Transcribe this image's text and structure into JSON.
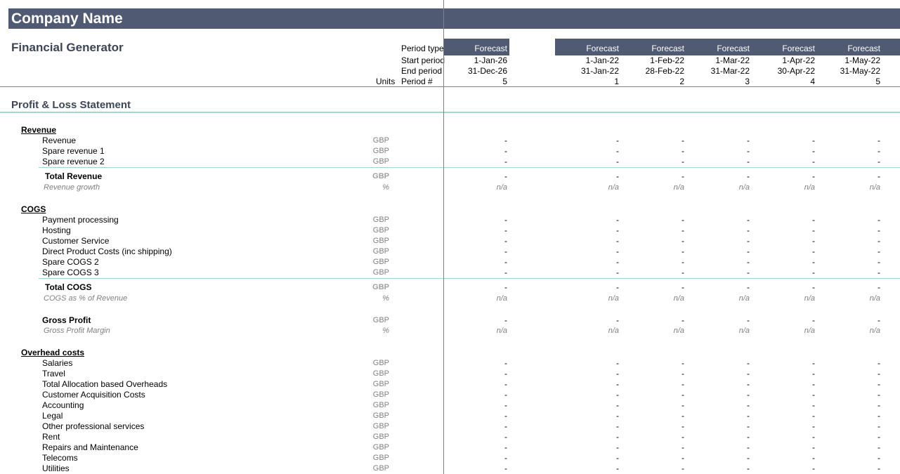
{
  "company_name": "Company Name",
  "app_title": "Financial Generator",
  "header_labels": {
    "period_type": "Period type",
    "start_period": "Start period",
    "end_period": "End period",
    "period_num": "Period #",
    "units": "Units"
  },
  "columns": [
    {
      "type": "Forecast",
      "start": "1-Jan-26",
      "end": "31-Dec-26",
      "period": "5"
    },
    {
      "type": "Forecast",
      "start": "1-Jan-22",
      "end": "31-Jan-22",
      "period": "1"
    },
    {
      "type": "Forecast",
      "start": "1-Feb-22",
      "end": "28-Feb-22",
      "period": "2"
    },
    {
      "type": "Forecast",
      "start": "1-Mar-22",
      "end": "31-Mar-22",
      "period": "3"
    },
    {
      "type": "Forecast",
      "start": "1-Apr-22",
      "end": "30-Apr-22",
      "period": "4"
    },
    {
      "type": "Forecast",
      "start": "1-May-22",
      "end": "31-May-22",
      "period": "5"
    }
  ],
  "section_title": "Profit & Loss Statement",
  "rows": [
    {
      "kind": "head",
      "label": "Revenue",
      "unit": "",
      "values": []
    },
    {
      "kind": "item",
      "label": "Revenue",
      "unit": "GBP",
      "values": [
        "-",
        "-",
        "-",
        "-",
        "-",
        "-"
      ]
    },
    {
      "kind": "item",
      "label": "Spare revenue 1",
      "unit": "GBP",
      "values": [
        "-",
        "-",
        "-",
        "-",
        "-",
        "-"
      ]
    },
    {
      "kind": "item",
      "label": "Spare revenue 2",
      "unit": "GBP",
      "values": [
        "-",
        "-",
        "-",
        "-",
        "-",
        "-"
      ]
    },
    {
      "kind": "total",
      "label": "Total Revenue",
      "unit": "GBP",
      "values": [
        "-",
        "-",
        "-",
        "-",
        "-",
        "-"
      ]
    },
    {
      "kind": "ratio",
      "label": "Revenue growth",
      "unit": "%",
      "values": [
        "n/a",
        "n/a",
        "n/a",
        "n/a",
        "n/a",
        "n/a"
      ]
    },
    {
      "kind": "head",
      "label": "COGS",
      "unit": "",
      "values": []
    },
    {
      "kind": "item",
      "label": "Payment processing",
      "unit": "GBP",
      "values": [
        "-",
        "-",
        "-",
        "-",
        "-",
        "-"
      ]
    },
    {
      "kind": "item",
      "label": "Hosting",
      "unit": "GBP",
      "values": [
        "-",
        "-",
        "-",
        "-",
        "-",
        "-"
      ]
    },
    {
      "kind": "item",
      "label": "Customer Service",
      "unit": "GBP",
      "values": [
        "-",
        "-",
        "-",
        "-",
        "-",
        "-"
      ]
    },
    {
      "kind": "item",
      "label": "Direct Product Costs (inc shipping)",
      "unit": "GBP",
      "values": [
        "-",
        "-",
        "-",
        "-",
        "-",
        "-"
      ]
    },
    {
      "kind": "item",
      "label": "Spare COGS 2",
      "unit": "GBP",
      "values": [
        "-",
        "-",
        "-",
        "-",
        "-",
        "-"
      ]
    },
    {
      "kind": "item",
      "label": "Spare COGS 3",
      "unit": "GBP",
      "values": [
        "-",
        "-",
        "-",
        "-",
        "-",
        "-"
      ]
    },
    {
      "kind": "total",
      "label": "Total COGS",
      "unit": "GBP",
      "values": [
        "-",
        "-",
        "-",
        "-",
        "-",
        "-"
      ]
    },
    {
      "kind": "ratio",
      "label": "COGS as % of Revenue",
      "unit": "%",
      "values": [
        "n/a",
        "n/a",
        "n/a",
        "n/a",
        "n/a",
        "n/a"
      ]
    },
    {
      "kind": "gp",
      "label": "Gross Profit",
      "unit": "GBP",
      "values": [
        "-",
        "-",
        "-",
        "-",
        "-",
        "-"
      ]
    },
    {
      "kind": "ratio",
      "label": "Gross Profit Margin",
      "unit": "%",
      "values": [
        "n/a",
        "n/a",
        "n/a",
        "n/a",
        "n/a",
        "n/a"
      ]
    },
    {
      "kind": "head",
      "label": "Overhead costs",
      "unit": "",
      "values": []
    },
    {
      "kind": "item",
      "label": "Salaries",
      "unit": "GBP",
      "values": [
        "-",
        "-",
        "-",
        "-",
        "-",
        "-"
      ]
    },
    {
      "kind": "item",
      "label": "Travel",
      "unit": "GBP",
      "values": [
        "-",
        "-",
        "-",
        "-",
        "-",
        "-"
      ]
    },
    {
      "kind": "item",
      "label": "Total Allocation based Overheads",
      "unit": "GBP",
      "values": [
        "-",
        "-",
        "-",
        "-",
        "-",
        "-"
      ]
    },
    {
      "kind": "item",
      "label": "Customer Acquisition Costs",
      "unit": "GBP",
      "values": [
        "-",
        "-",
        "-",
        "-",
        "-",
        "-"
      ]
    },
    {
      "kind": "item",
      "label": "Accounting",
      "unit": "GBP",
      "values": [
        "-",
        "-",
        "-",
        "-",
        "-",
        "-"
      ]
    },
    {
      "kind": "item",
      "label": "Legal",
      "unit": "GBP",
      "values": [
        "-",
        "-",
        "-",
        "-",
        "-",
        "-"
      ]
    },
    {
      "kind": "item",
      "label": "Other professional services",
      "unit": "GBP",
      "values": [
        "-",
        "-",
        "-",
        "-",
        "-",
        "-"
      ]
    },
    {
      "kind": "item",
      "label": "Rent",
      "unit": "GBP",
      "values": [
        "-",
        "-",
        "-",
        "-",
        "-",
        "-"
      ]
    },
    {
      "kind": "item",
      "label": "Repairs and Maintenance",
      "unit": "GBP",
      "values": [
        "-",
        "-",
        "-",
        "-",
        "-",
        "-"
      ]
    },
    {
      "kind": "item",
      "label": "Telecoms",
      "unit": "GBP",
      "values": [
        "-",
        "-",
        "-",
        "-",
        "-",
        "-"
      ]
    },
    {
      "kind": "item",
      "label": "Utilities",
      "unit": "GBP",
      "values": [
        "-",
        "-",
        "-",
        "-",
        "-",
        "-"
      ]
    }
  ]
}
